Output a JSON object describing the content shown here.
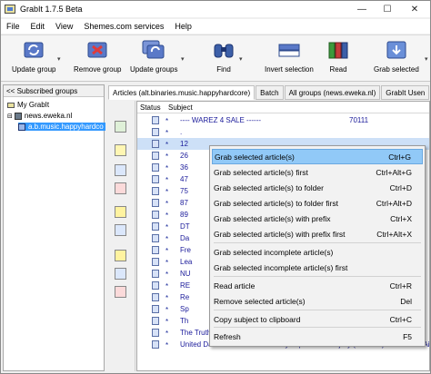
{
  "window": {
    "title": "GrabIt 1.7.5 Beta"
  },
  "menu": [
    "File",
    "Edit",
    "View",
    "Shemes.com services",
    "Help"
  ],
  "toolbar": [
    {
      "label": "Update group",
      "icon": "refresh-icon"
    },
    {
      "label": "Remove group",
      "icon": "remove-icon"
    },
    {
      "label": "Update groups",
      "icon": "refresh-all-icon"
    },
    {
      "label": "Find",
      "icon": "binoculars-icon"
    },
    {
      "label": "Invert selection",
      "icon": "invert-icon"
    },
    {
      "label": "Read",
      "icon": "books-icon"
    },
    {
      "label": "Grab selected",
      "icon": "grab-icon"
    }
  ],
  "left_pane": {
    "header": "<< Subscribed groups",
    "tree": [
      {
        "label": "My GrabIt"
      },
      {
        "label": "news.eweka.nl"
      },
      {
        "label": "a.b.music.happyhardco"
      }
    ]
  },
  "tabs": [
    {
      "label": "Articles (alt.binaries.music.happyhardcore)",
      "active": true
    },
    {
      "label": "Batch",
      "active": false
    },
    {
      "label": "All groups (news.eweka.nl)",
      "active": false
    },
    {
      "label": "GrabIt Usen",
      "active": false
    }
  ],
  "columns": {
    "status": "Status",
    "subject": "Subject"
  },
  "rows": [
    {
      "dot": "*",
      "subject": "---- WAREZ 4 SALE ------",
      "num": "70111"
    },
    {
      "dot": "*",
      "subject": ".",
      "num": ""
    },
    {
      "dot": "*",
      "subject": "12",
      "num": ""
    },
    {
      "dot": "*",
      "subject": "26",
      "num": ""
    },
    {
      "dot": "*",
      "subject": "36",
      "num": ""
    },
    {
      "dot": "*",
      "subject": "47",
      "num": ""
    },
    {
      "dot": "*",
      "subject": "75",
      "num": ""
    },
    {
      "dot": "*",
      "subject": "87",
      "num": ""
    },
    {
      "dot": "*",
      "subject": "89",
      "num": ""
    },
    {
      "dot": "*",
      "subject": "DT",
      "num": ""
    },
    {
      "dot": "*",
      "subject": "Da",
      "num": ""
    },
    {
      "dot": "*",
      "subject": "Fre",
      "num": ""
    },
    {
      "dot": "*",
      "subject": "Lea",
      "num": ""
    },
    {
      "dot": "*",
      "subject": "NU",
      "num": ""
    },
    {
      "dot": "*",
      "subject": "RE",
      "num": ""
    },
    {
      "dot": "*",
      "subject": "Re",
      "num": ""
    },
    {
      "dot": "*",
      "subject": "Sp",
      "num": ""
    },
    {
      "dot": "*",
      "subject": "Th",
      "num": ""
    },
    {
      "dot": "*",
      "subject": "The TruthNBP Unregistered.",
      "num": ""
    },
    {
      "dot": "*",
      "subject": "United Dance Volume 4-Mixed By Slipmatt And Dj Sy (10 of 32) \"06. Brisk - Airh",
      "num": ""
    }
  ],
  "context_menu": [
    {
      "label": "Grab selected article(s)",
      "shortcut": "Ctrl+G"
    },
    {
      "label": "Grab selected article(s) first",
      "shortcut": "Ctrl+Alt+G"
    },
    {
      "label": "Grab selected article(s) to folder",
      "shortcut": "Ctrl+D"
    },
    {
      "label": "Grab selected article(s) to folder first",
      "shortcut": "Ctrl+Alt+D"
    },
    {
      "label": "Grab selected article(s) with prefix",
      "shortcut": "Ctrl+X"
    },
    {
      "label": "Grab selected article(s) with prefix first",
      "shortcut": "Ctrl+Alt+X"
    },
    {
      "label": "Grab selected incomplete article(s)",
      "shortcut": ""
    },
    {
      "label": "Grab selected incomplete article(s) first",
      "shortcut": ""
    },
    {
      "label": "Read article",
      "shortcut": "Ctrl+R"
    },
    {
      "label": "Remove selected article(s)",
      "shortcut": "Del"
    },
    {
      "label": "Copy subject to clipboard",
      "shortcut": "Ctrl+C"
    },
    {
      "label": "Refresh",
      "shortcut": "F5"
    }
  ],
  "colors": {
    "highlight": "#91c9f7",
    "link_text": "#1a1a9a",
    "selected_row": "#cde0f7"
  }
}
